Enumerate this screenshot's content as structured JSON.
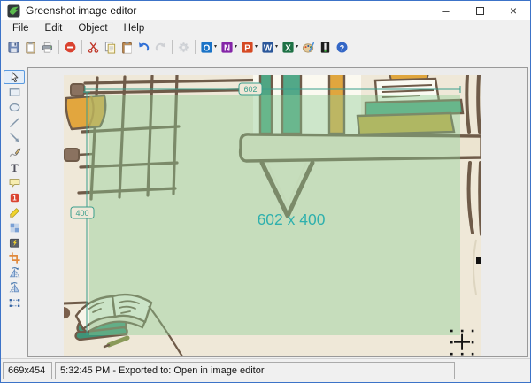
{
  "window": {
    "title": "Greenshot image editor",
    "border_color": "#3c73c8"
  },
  "window_controls": {
    "minimize_glyph": "–",
    "close_glyph": "×"
  },
  "menu": {
    "items": [
      "File",
      "Edit",
      "Object",
      "Help"
    ]
  },
  "toolbar": {
    "items": [
      {
        "name": "save-button",
        "icon": "save-icon"
      },
      {
        "name": "copy-to-clipboard-button",
        "icon": "clipboard-icon"
      },
      {
        "name": "print-button",
        "icon": "print-icon"
      },
      {
        "separator": true
      },
      {
        "name": "delete-button",
        "icon": "delete-icon"
      },
      {
        "separator": true
      },
      {
        "name": "cut-button",
        "icon": "cut-icon"
      },
      {
        "name": "copy-button",
        "icon": "copy-icon"
      },
      {
        "name": "paste-button",
        "icon": "paste-icon"
      },
      {
        "name": "undo-button",
        "icon": "undo-icon"
      },
      {
        "name": "redo-button",
        "icon": "redo-icon",
        "disabled": true
      },
      {
        "separator": true
      },
      {
        "name": "settings-button",
        "icon": "settings-icon",
        "disabled": true
      },
      {
        "separator": true
      },
      {
        "name": "export-outlook-button",
        "icon": "outlook-icon",
        "dropdown": true
      },
      {
        "name": "export-onenote-button",
        "icon": "onenote-icon",
        "dropdown": true
      },
      {
        "name": "export-powerpoint-button",
        "icon": "powerpoint-icon",
        "dropdown": true
      },
      {
        "name": "export-word-button",
        "icon": "word-icon",
        "dropdown": true
      },
      {
        "name": "export-excel-button",
        "icon": "excel-icon",
        "dropdown": true
      },
      {
        "name": "export-paint-button",
        "icon": "paint-icon"
      },
      {
        "name": "export-image-editor-button",
        "icon": "greenshot-icon"
      },
      {
        "name": "help-button",
        "icon": "help-icon"
      }
    ]
  },
  "tools": [
    {
      "name": "tool-cursor",
      "icon": "cursor-icon",
      "selected": true
    },
    {
      "name": "tool-rectangle",
      "icon": "rectangle-icon"
    },
    {
      "name": "tool-ellipse",
      "icon": "ellipse-icon"
    },
    {
      "name": "tool-line",
      "icon": "line-icon"
    },
    {
      "name": "tool-arrow",
      "icon": "arrow-icon"
    },
    {
      "name": "tool-freehand",
      "icon": "freehand-icon"
    },
    {
      "name": "tool-text",
      "icon": "text-icon"
    },
    {
      "name": "tool-speechbubble",
      "icon": "speechbubble-icon"
    },
    {
      "name": "tool-counter",
      "icon": "counter-icon"
    },
    {
      "name": "tool-highlight",
      "icon": "highlight-icon"
    },
    {
      "name": "tool-obfuscate",
      "icon": "obfuscate-icon"
    },
    {
      "name": "tool-effects",
      "icon": "effects-icon"
    },
    {
      "name": "tool-crop",
      "icon": "crop-icon"
    },
    {
      "name": "tool-rotate-cw",
      "icon": "rotate-cw-icon"
    },
    {
      "name": "tool-rotate-ccw",
      "icon": "rotate-ccw-icon"
    },
    {
      "name": "tool-resize",
      "icon": "resize-icon"
    }
  ],
  "canvas": {
    "selection_width_label": "602",
    "selection_height_label": "400",
    "selection_size_label": "602 x 400",
    "size_label_color": "#2fb0ad",
    "measure_color": "#3a9e8c"
  },
  "statusbar": {
    "dimensions": "669x454",
    "message": "5:32:45 PM - Exported to: Open in image editor"
  },
  "colors": {
    "selection_overlay": "#8ccd96",
    "illustration_background": "#efe8d8",
    "outline_brown": "#6f5b49",
    "book_teal": "#4fa583",
    "book_yellow": "#e0a63e",
    "book_olive": "#c9a83f"
  }
}
